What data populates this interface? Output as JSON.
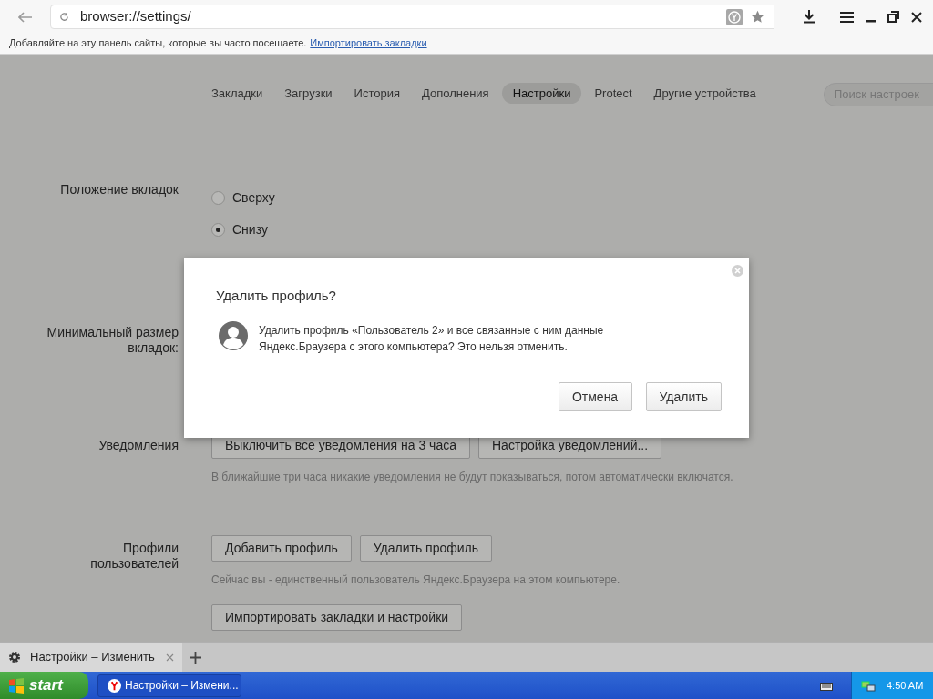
{
  "address_bar": {
    "url": "browser://settings/"
  },
  "bookmarks_bar": {
    "text": "Добавляйте на эту панель сайты, которые вы часто посещаете.",
    "link": "Импортировать закладки"
  },
  "nav": {
    "tabs": [
      {
        "label": "Закладки",
        "selected": false
      },
      {
        "label": "Загрузки",
        "selected": false
      },
      {
        "label": "История",
        "selected": false
      },
      {
        "label": "Дополнения",
        "selected": false
      },
      {
        "label": "Настройки",
        "selected": true
      },
      {
        "label": "Protect",
        "selected": false
      },
      {
        "label": "Другие устройства",
        "selected": false
      }
    ],
    "search": {
      "placeholder": "Поиск настроек"
    }
  },
  "settings": [
    {
      "kind": "radio",
      "label": "Положение вкладок",
      "options": [
        {
          "label": "Сверху",
          "selected": false
        },
        {
          "label": "Снизу",
          "selected": true
        }
      ]
    },
    {
      "kind": "label",
      "label": "Минимальный размер вкладок:"
    },
    {
      "kind": "buttons",
      "label": "Уведомления",
      "buttons": [
        "Выключить все уведомления на 3 часа",
        "Настройка уведомлений..."
      ],
      "hint": "В ближайшие три часа никакие уведомления не будут показываться, потом автоматически включатся."
    },
    {
      "kind": "buttons",
      "label": "Профили пользователей",
      "buttons": [
        "Добавить профиль",
        "Удалить профиль"
      ],
      "hint": "Сейчас вы - единственный пользователь Яндекс.Браузера на этом компьютере.",
      "extra_button": "Импортировать закладки и настройки"
    }
  ],
  "dialog": {
    "title": "Удалить профиль?",
    "message": "Удалить профиль «Пользователь 2» и все связанные с ним данные Яндекс.Браузера с этого компьютера? Это нельзя отменить.",
    "buttons": [
      "Отмена",
      "Удалить"
    ]
  },
  "browser_tabs": [
    {
      "title": "Настройки – Изменить",
      "selected": true
    }
  ],
  "taskbar": {
    "start": "start",
    "tasks": [
      {
        "title": "Настройки – Измени..."
      }
    ],
    "clock": "4:50 AM"
  }
}
